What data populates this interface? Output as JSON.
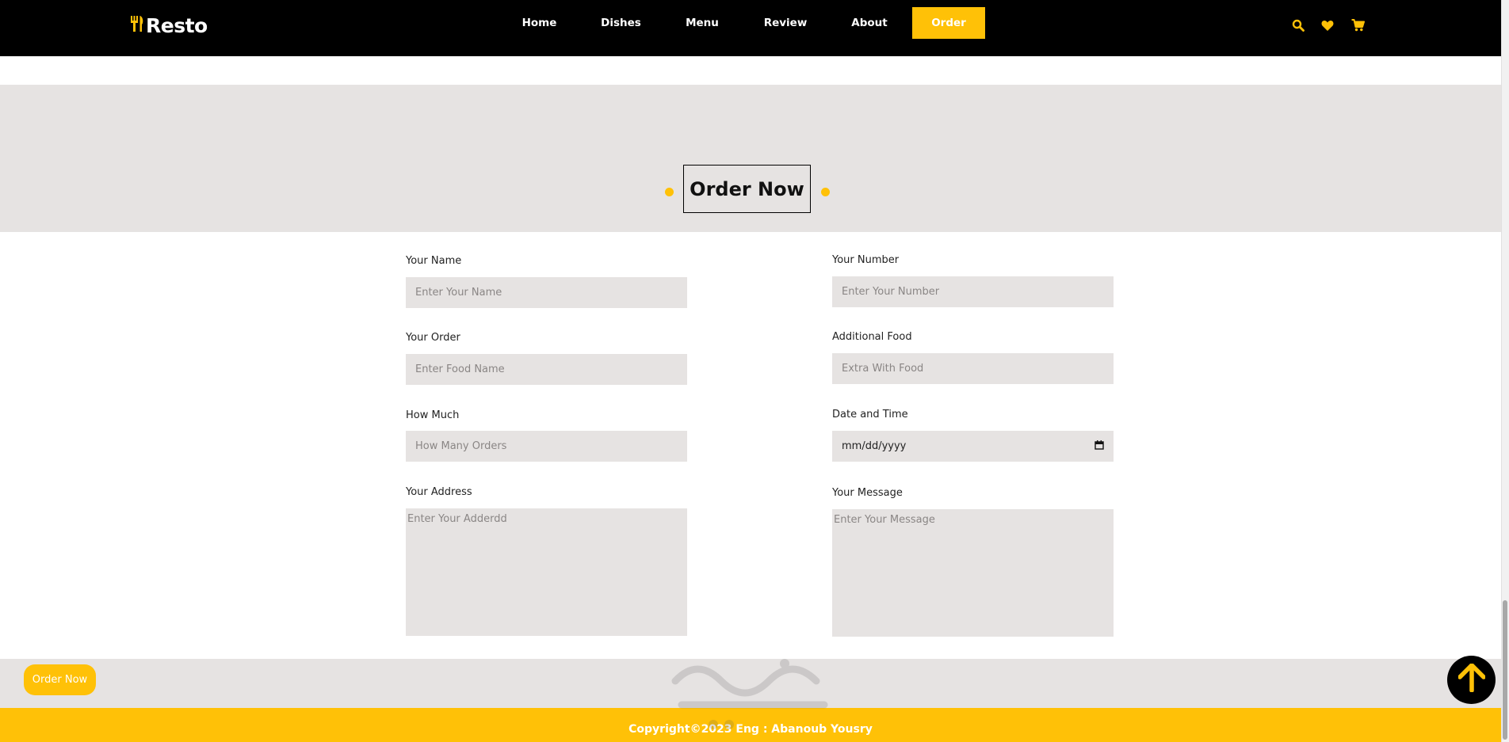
{
  "header": {
    "logo_text": "Resto",
    "nav": [
      {
        "label": "Home"
      },
      {
        "label": "Dishes"
      },
      {
        "label": "Menu"
      },
      {
        "label": "Review"
      },
      {
        "label": "About"
      },
      {
        "label": "Order",
        "active": true
      }
    ],
    "icons": [
      "search-icon",
      "heart-icon",
      "cart-icon"
    ]
  },
  "section": {
    "heading": "Order Now"
  },
  "form": {
    "name": {
      "label": "Your Name",
      "placeholder": "Enter Your Name"
    },
    "number": {
      "label": "Your Number",
      "placeholder": "Enter Your Number"
    },
    "order": {
      "label": "Your Order",
      "placeholder": "Enter Food Name"
    },
    "additional": {
      "label": "Additional Food",
      "placeholder": "Extra With Food"
    },
    "how_much": {
      "label": "How Much",
      "placeholder": "How Many Orders"
    },
    "date_time": {
      "label": "Date and Time",
      "value": "mm/dd/yyyy"
    },
    "address": {
      "label": "Your Address",
      "placeholder": "Enter Your Adderdd"
    },
    "message": {
      "label": "Your Message",
      "placeholder": "Enter Your Message"
    }
  },
  "floating": {
    "order_button": "Order Now"
  },
  "footer": {
    "copyright": "Copyright©2023 Eng : Abanoub Yousry"
  },
  "colors": {
    "accent": "#ffc107",
    "header_bg": "#000000",
    "band_bg": "#e6e3e2",
    "field_bg": "#e6e3e2"
  }
}
